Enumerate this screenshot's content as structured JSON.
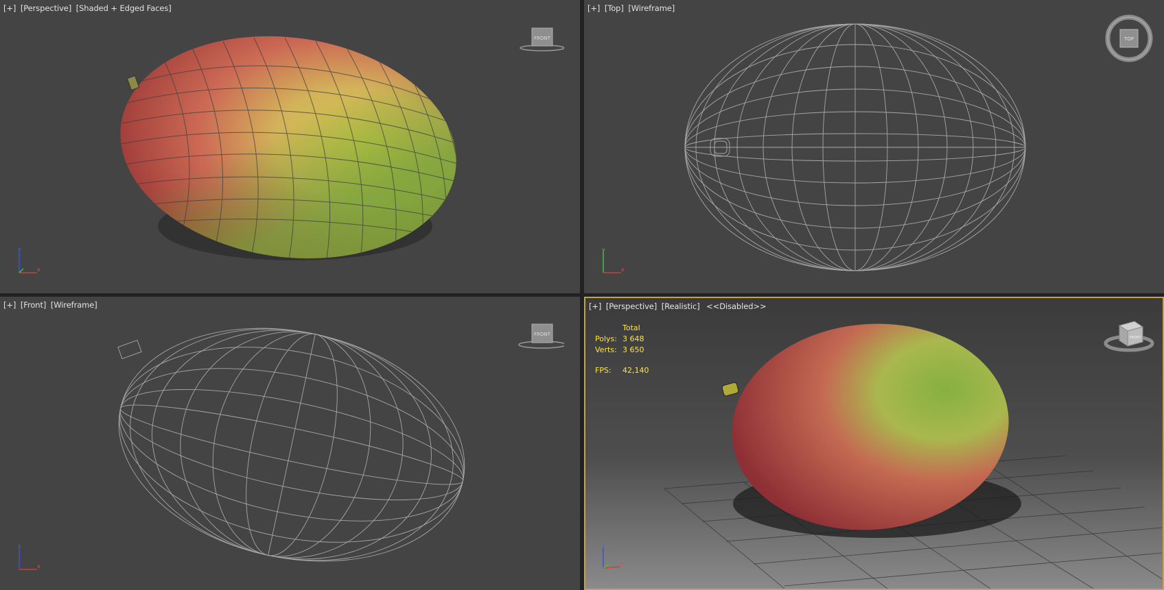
{
  "viewports": {
    "top_left": {
      "plus": "[+]",
      "view": "[Perspective]",
      "mode": "[Shaded + Edged Faces]",
      "cube": "FRONT"
    },
    "top_right": {
      "plus": "[+]",
      "view": "[Top]",
      "mode": "[Wireframe]",
      "cube": "TOP"
    },
    "bottom_left": {
      "plus": "[+]",
      "view": "[Front]",
      "mode": "[Wireframe]",
      "cube": "FRONT"
    },
    "bottom_right": {
      "plus": "[+]",
      "view": "[Perspective]",
      "mode": "[Realistic]",
      "extra": "<<Disabled>>",
      "cube": "FRONT"
    }
  },
  "stats": {
    "header": "Total",
    "polys_label": "Polys:",
    "polys_value": "3 648",
    "verts_label": "Verts:",
    "verts_value": "3 650",
    "fps_label": "FPS:",
    "fps_value": "42,140"
  },
  "axis_labels": {
    "x": "x",
    "y": "y",
    "z": "z"
  },
  "colors": {
    "viewport_bg": "#444444",
    "active_border": "#c9a43a",
    "stats_text": "#ffe34c",
    "wire": "#a8a8a8"
  },
  "icons": [
    "viewcube-icon",
    "axis-tripod-icon",
    "steering-wheel-icon"
  ]
}
